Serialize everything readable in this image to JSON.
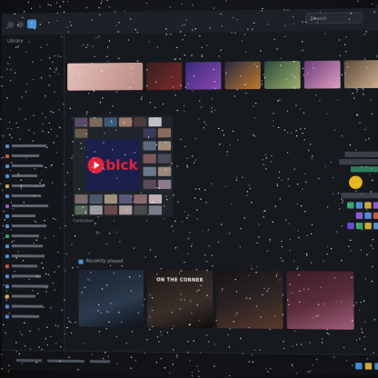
{
  "window": {
    "search_placeholder": "Search",
    "sidebar_heading": "Library"
  },
  "colors": {
    "accent": "#e0233a",
    "sidebar_bg": "#13161a",
    "content_bg": "#16191e",
    "link": "#4a90d9"
  },
  "featured": {
    "logo_text": "blck",
    "caption": "Collection"
  },
  "shelf": {
    "label": "Recently played"
  },
  "cards": [
    {
      "title": "",
      "color": "#2b3a4d"
    },
    {
      "title": "ON THE CORNER",
      "color": "#3a2f2a"
    },
    {
      "title": "",
      "color": "#2c2424"
    },
    {
      "title": "",
      "color": "#5a2c3c"
    }
  ],
  "icons": [
    "app-icon",
    "search-icon",
    "play-icon",
    "folder-icon",
    "emoji-icon"
  ]
}
